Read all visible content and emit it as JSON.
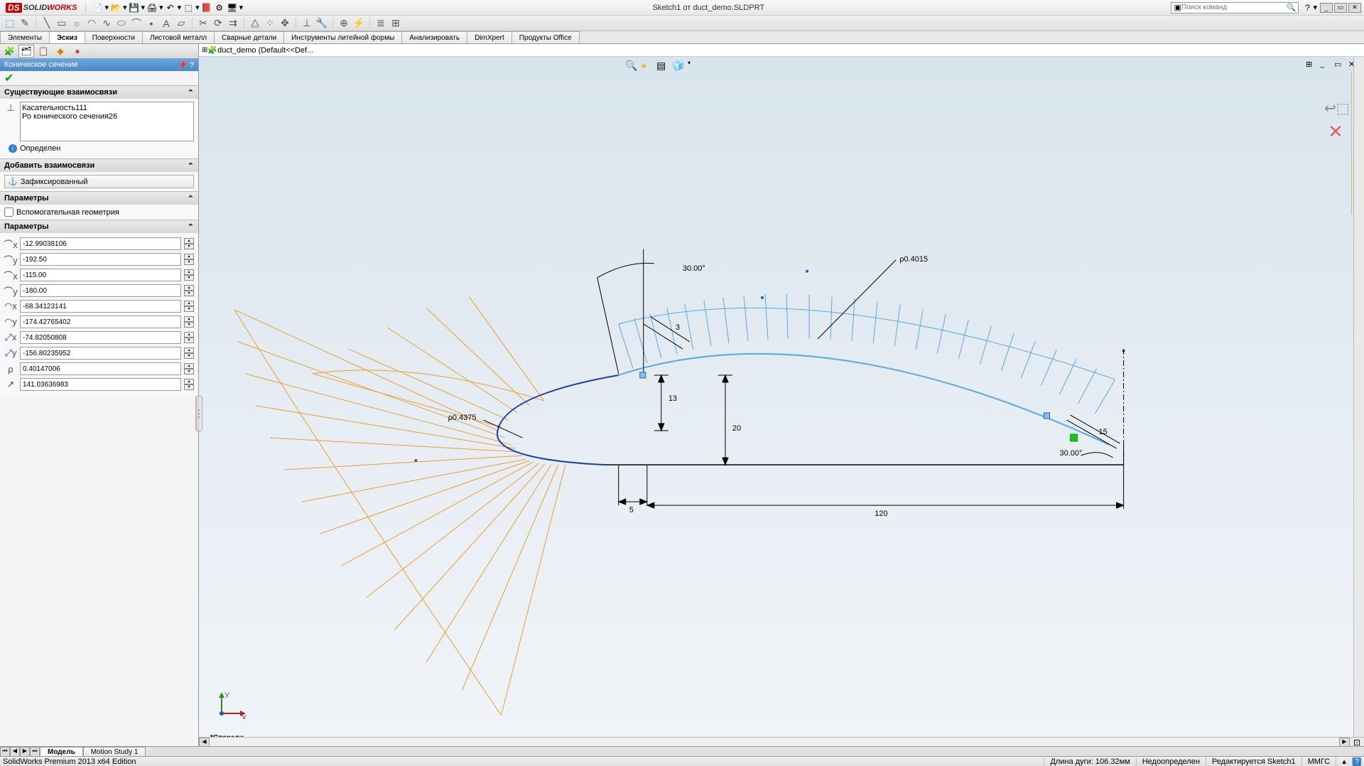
{
  "app": {
    "logo1": "S",
    "logo2": "SOLID",
    "logo3": "WORKS",
    "title": "Sketch1 от duct_demo.SLDPRT"
  },
  "search": {
    "placeholder": "Поиск команд"
  },
  "tabs": [
    "Элементы",
    "Эскиз",
    "Поверхности",
    "Листовой металл",
    "Сварные детали",
    "Инструменты литейной формы",
    "Анализировать",
    "DimXpert",
    "Продукты Office"
  ],
  "feature": {
    "title": "Коническое сечение",
    "existing_head": "Существующие взаимосвязи",
    "rel1": "Касательность111",
    "rel2": "Ро конического сечения26",
    "status": "Определен",
    "add_head": "Добавить взаимосвязи",
    "fixed": "Зафиксированный",
    "params_head": "Параметры",
    "aux_geom": "Вспомогательная геометрия",
    "params2_head": "Параметры",
    "p": [
      "-12.99038106",
      "-192.50",
      "-115.00",
      "-180.00",
      "-68.34123141",
      "-174.42765402",
      "-74.82050808",
      "-156.80235952",
      "0.40147006",
      "141.03636983"
    ]
  },
  "tree": {
    "root": "duct_demo  (Default<<Def..."
  },
  "dims": {
    "ang1": "30.00°",
    "rho1": "ρ0.4015",
    "rho2": "ρ0.4375",
    "d3": "3",
    "d13": "13",
    "d20": "20",
    "d5": "5",
    "d120": "120",
    "d15": "15",
    "ang2": "30.00°"
  },
  "bottom": {
    "model": "Модель",
    "motion": "Motion Study 1",
    "front": "*Спереди"
  },
  "status": {
    "edition": "SolidWorks Premium 2013 x64 Edition",
    "arc": "Длина дуги: 106.32мм",
    "under": "Недоопределен",
    "editing": "Редактируется Sketch1",
    "units": "ММГС"
  }
}
